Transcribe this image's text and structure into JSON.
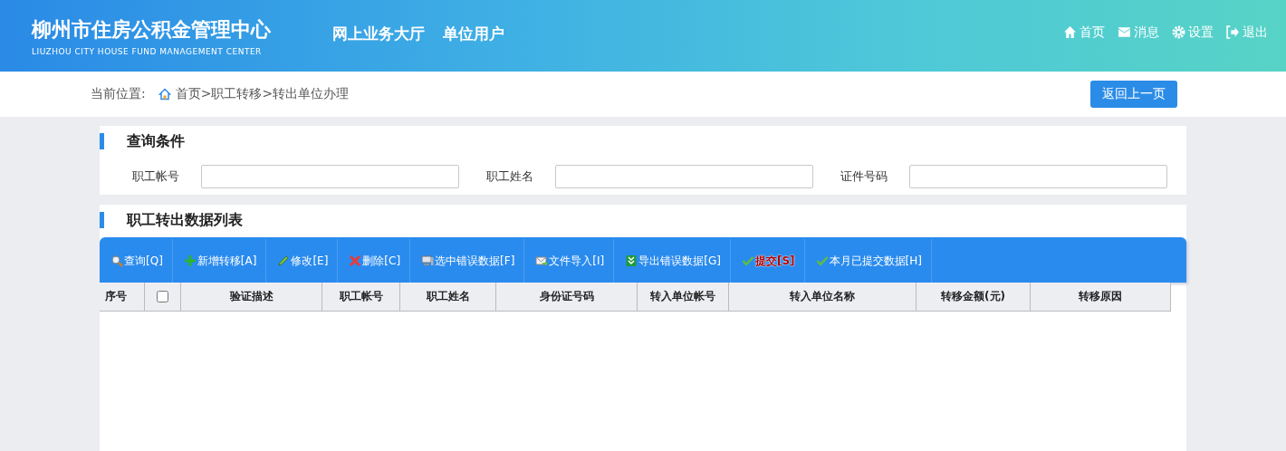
{
  "header": {
    "title": "柳州市住房公积金管理中心",
    "subtitle": "LIUZHOU CITY HOUSE FUND MANAGEMENT CENTER",
    "nav": [
      {
        "label": "网上业务大厅"
      },
      {
        "label": "单位用户"
      }
    ],
    "links": [
      {
        "label": "首页",
        "kind": "home"
      },
      {
        "label": "消息",
        "kind": "mail"
      },
      {
        "label": "设置",
        "kind": "gear"
      },
      {
        "label": "退出",
        "kind": "exit"
      }
    ]
  },
  "breadcrumb": {
    "prefix": "当前位置:",
    "home": "首页",
    "path": " >职工转移>转出单位办理",
    "back": "返回上一页"
  },
  "query": {
    "title": "查询条件",
    "fields": [
      {
        "label": "职工帐号"
      },
      {
        "label": "职工姓名"
      },
      {
        "label": "证件号码"
      }
    ]
  },
  "list": {
    "title": "职工转出数据列表",
    "toolbar": [
      {
        "label": "查询[Q]",
        "kind": "search",
        "emphasis": false
      },
      {
        "label": "新增转移[A]",
        "kind": "add",
        "emphasis": false
      },
      {
        "label": "修改[E]",
        "kind": "edit",
        "emphasis": false
      },
      {
        "label": "删除[C]",
        "kind": "delete",
        "emphasis": false
      },
      {
        "label": "选中错误数据[F]",
        "kind": "computer",
        "emphasis": false
      },
      {
        "label": "文件导入[I]",
        "kind": "mail",
        "emphasis": false
      },
      {
        "label": "导出错误数据[G]",
        "kind": "export",
        "emphasis": false
      },
      {
        "label": "提交[S]",
        "kind": "check",
        "emphasis": true
      },
      {
        "label": "本月已提交数据[H]",
        "kind": "check",
        "emphasis": false
      }
    ],
    "columns": [
      {
        "kind": "text",
        "label": "序号"
      },
      {
        "kind": "checkbox",
        "checked": false
      },
      {
        "kind": "text",
        "label": "验证描述"
      },
      {
        "kind": "text",
        "label": "职工帐号"
      },
      {
        "kind": "text",
        "label": "职工姓名"
      },
      {
        "kind": "text",
        "label": "身份证号码"
      },
      {
        "kind": "text",
        "label": "转入单位帐号"
      },
      {
        "kind": "text",
        "label": "转入单位名称"
      },
      {
        "kind": "text",
        "label": "转移金额(元)"
      },
      {
        "kind": "text",
        "label": "转移原因"
      }
    ]
  }
}
